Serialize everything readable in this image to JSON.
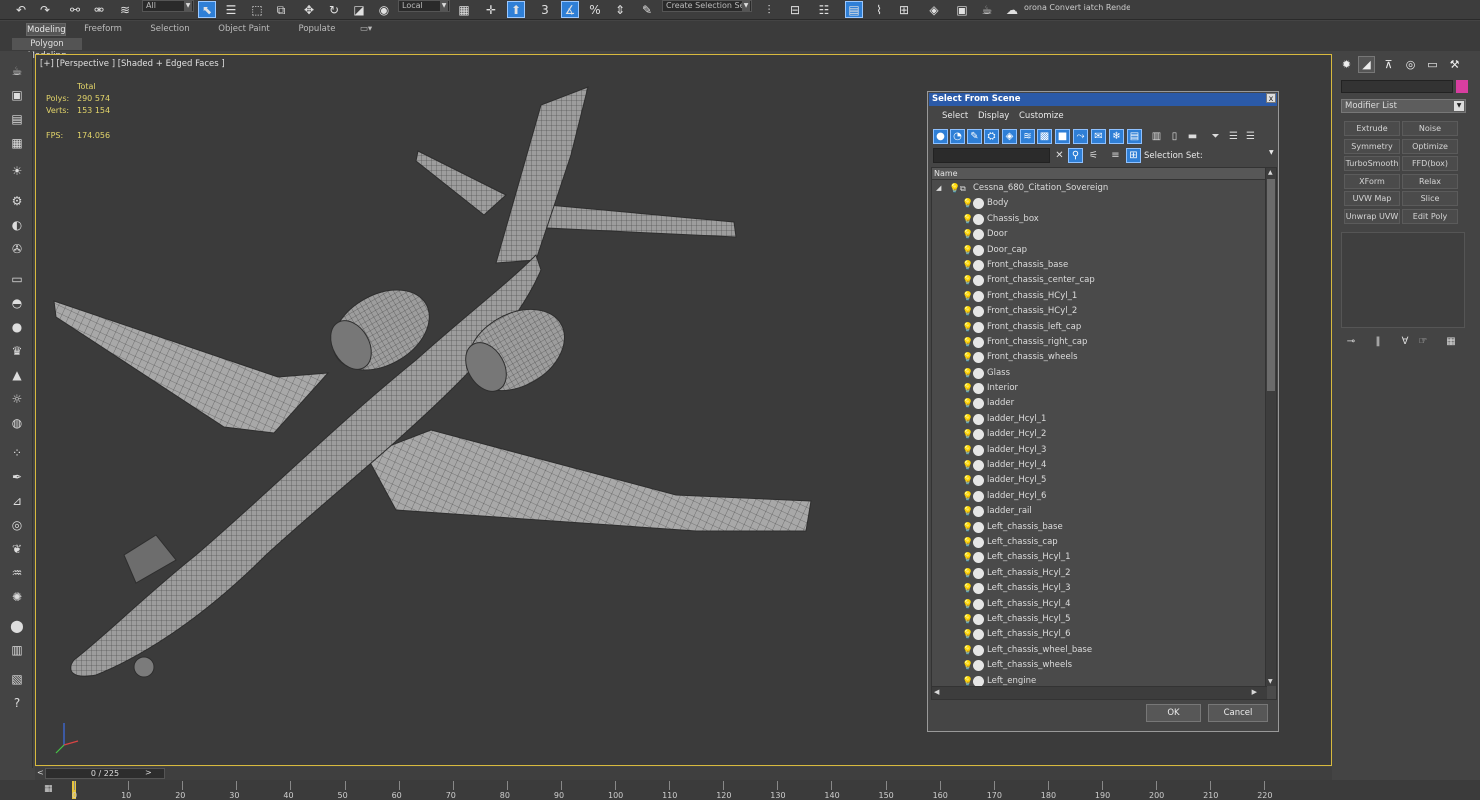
{
  "toolbar": {
    "filter_value": "All",
    "coord_value": "Local",
    "selection_set_value": "Create Selection Se",
    "render_text": "orona Convert iatch Render..."
  },
  "ribbon": {
    "tabs": [
      "Modeling",
      "Freeform",
      "Selection",
      "Object Paint",
      "Populate"
    ],
    "active_tab": "Modeling",
    "sub_label": "Polygon Modeling"
  },
  "viewport": {
    "label": "[+] [Perspective ] [Shaded + Edged Faces ]",
    "stats": {
      "total_label": "Total",
      "polys_label": "Polys:",
      "polys_value": "290 574",
      "verts_label": "Verts:",
      "verts_value": "153 154",
      "fps_label": "FPS:",
      "fps_value": "174.056"
    }
  },
  "dialog": {
    "title": "Select From Scene",
    "close_label": "x",
    "menu": [
      "Select",
      "Display",
      "Customize"
    ],
    "selection_set_label": "Selection Set:",
    "column_name": "Name",
    "root_item": "Cessna_680_Citation_Sovereign",
    "items": [
      "Body",
      "Chassis_box",
      "Door",
      "Door_cap",
      "Front_chassis_base",
      "Front_chassis_center_cap",
      "Front_chassis_HCyl_1",
      "Front_chassis_HCyl_2",
      "Front_chassis_left_cap",
      "Front_chassis_right_cap",
      "Front_chassis_wheels",
      "Glass",
      "Interior",
      "ladder",
      "ladder_Hcyl_1",
      "ladder_Hcyl_2",
      "ladder_Hcyl_3",
      "ladder_Hcyl_4",
      "ladder_Hcyl_5",
      "ladder_Hcyl_6",
      "ladder_rail",
      "Left_chassis_base",
      "Left_chassis_cap",
      "Left_chassis_Hcyl_1",
      "Left_chassis_Hcyl_2",
      "Left_chassis_Hcyl_3",
      "Left_chassis_Hcyl_4",
      "Left_chassis_Hcyl_5",
      "Left_chassis_Hcyl_6",
      "Left_chassis_wheel_base",
      "Left_chassis_wheels",
      "Left_engine"
    ],
    "ok_label": "OK",
    "cancel_label": "Cancel"
  },
  "command_panel": {
    "modifier_list_label": "Modifier List",
    "modifier_buttons": [
      [
        "Extrude",
        "Noise"
      ],
      [
        "Symmetry",
        "Optimize"
      ],
      [
        "TurboSmooth",
        "FFD(box)"
      ],
      [
        "XForm",
        "Relax"
      ],
      [
        "UVW Map",
        "Slice"
      ],
      [
        "Unwrap UVW",
        "Edit Poly"
      ]
    ]
  },
  "timeline": {
    "frame_display": "0 / 225",
    "prev_label": "<",
    "next_label": ">",
    "ticks": [
      "0",
      "10",
      "20",
      "30",
      "40",
      "50",
      "60",
      "70",
      "80",
      "90",
      "100",
      "110",
      "120",
      "130",
      "140",
      "150",
      "160",
      "170",
      "180",
      "190",
      "200",
      "210",
      "220"
    ]
  },
  "colors": {
    "viewport_border": "#d8ba3e",
    "stats_text": "#e3d56a",
    "dialog_title_bg": "#2b5aa8",
    "accent_blue": "#2f7fd6",
    "object_color_swatch": "#d83ea0"
  }
}
